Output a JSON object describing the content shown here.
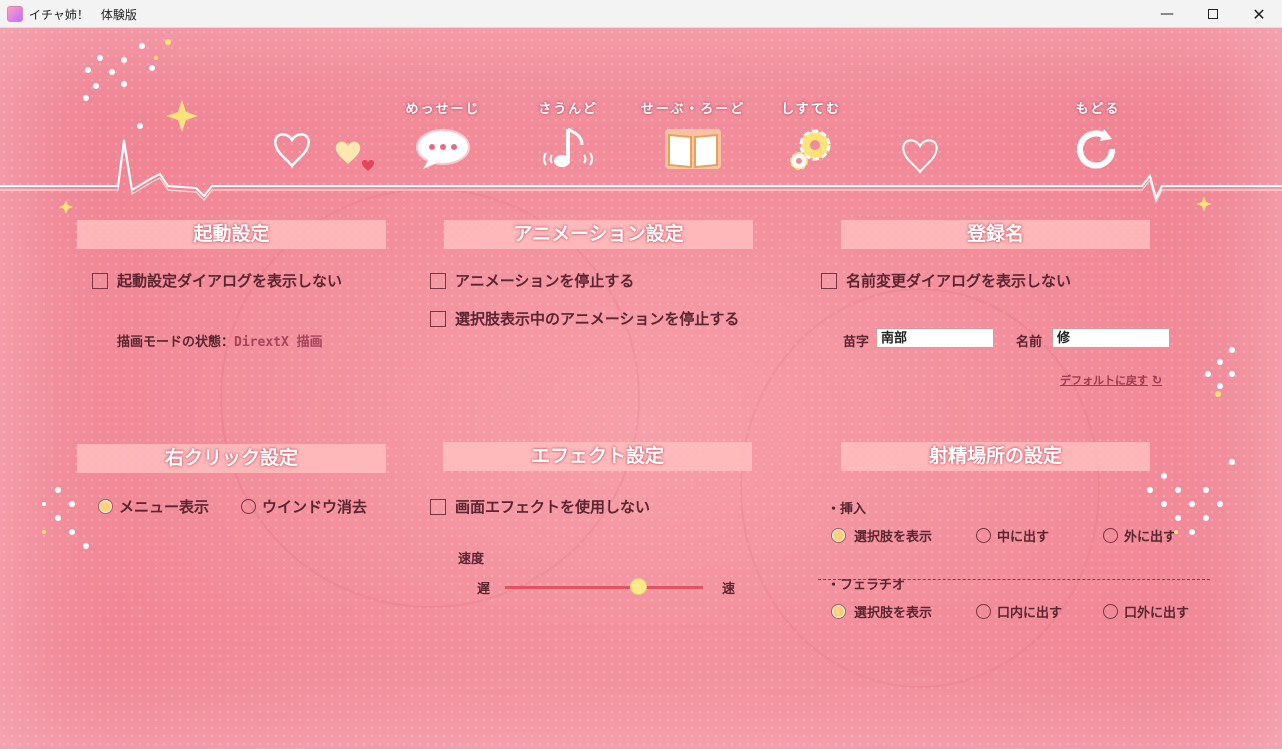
{
  "window": {
    "title": "イチャ姉！　体験版"
  },
  "nav": [
    {
      "key": "message",
      "label": "めっせーじ",
      "icon": "speech-bubble-icon"
    },
    {
      "key": "sound",
      "label": "さうんど",
      "icon": "music-note-icon"
    },
    {
      "key": "saveload",
      "label": "せーぶ・ろーど",
      "icon": "open-book-icon"
    },
    {
      "key": "system",
      "label": "しすてむ",
      "icon": "gear-icon"
    },
    {
      "key": "back",
      "label": "もどる",
      "icon": "return-arrow-icon"
    }
  ],
  "startup": {
    "heading": "起動設定",
    "hide_dialog": "起動設定ダイアログを表示しない",
    "render_mode_label": "描画モードの状態：",
    "render_mode_value": "DirextX 描画"
  },
  "animation": {
    "heading": "アニメーション設定",
    "stop_anim": "アニメーションを停止する",
    "stop_choice_anim": "選択肢表示中のアニメーションを停止する"
  },
  "register": {
    "heading": "登録名",
    "hide_rename": "名前変更ダイアログを表示しない",
    "surname_label": "苗字",
    "surname_value": "南部",
    "name_label": "名前",
    "name_value": "修",
    "default_link": "デフォルトに戻す"
  },
  "rightclick": {
    "heading": "右クリック設定",
    "opt_menu": "メニュー表示",
    "opt_hide": "ウインドウ消去",
    "selected": "メニュー表示"
  },
  "effect": {
    "heading": "エフェクト設定",
    "disable": "画面エフェクトを使用しない",
    "speed_label": "速度",
    "slow": "遅",
    "fast": "速",
    "speed_value": 0.67
  },
  "ejac": {
    "heading": "射精場所の設定",
    "insert_label": "・挿入",
    "insert_opts": [
      "選択肢を表示",
      "中に出す",
      "外に出す"
    ],
    "insert_selected": "選択肢を表示",
    "fella_label": "・フェラチオ",
    "fella_opts": [
      "選択肢を表示",
      "口内に出す",
      "口外に出す"
    ],
    "fella_selected": "選択肢を表示"
  },
  "colors": {
    "accent": "#ffd27a",
    "text": "#5a2430",
    "header_bg": "#ffbebe",
    "bg": "#f08a98"
  }
}
